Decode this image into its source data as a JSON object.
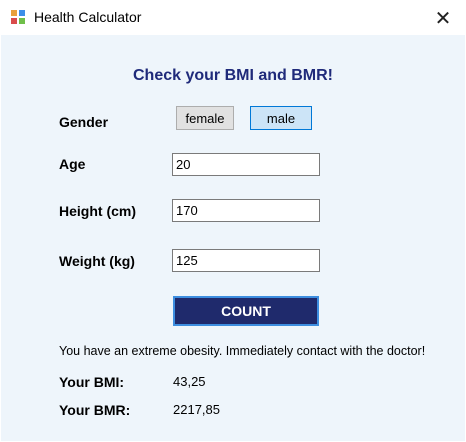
{
  "window": {
    "title": "Health Calculator",
    "close_glyph": "✕"
  },
  "heading": "Check your BMI and BMR!",
  "gender": {
    "label": "Gender",
    "options": [
      "female",
      "male"
    ],
    "selected": "male"
  },
  "age": {
    "label": "Age",
    "value": "20"
  },
  "height": {
    "label": "Height (cm)",
    "value": "170"
  },
  "weight": {
    "label": "Weight (kg)",
    "value": "125"
  },
  "count_button": "COUNT",
  "result": {
    "message": "You have an extreme obesity. Immediately contact with the doctor!",
    "bmi_label": "Your BMI:",
    "bmi_value": "43,25",
    "bmr_label": "Your BMR:",
    "bmr_value": "2217,85"
  },
  "colors": {
    "heading": "#1f2a7a",
    "client_bg": "#eef5fb",
    "count_bg": "#1f2a6c",
    "count_border": "#3d8ee0",
    "selected_bg": "#cce4f7"
  },
  "icons": {
    "app": "app-window-icon",
    "close": "close-icon"
  }
}
